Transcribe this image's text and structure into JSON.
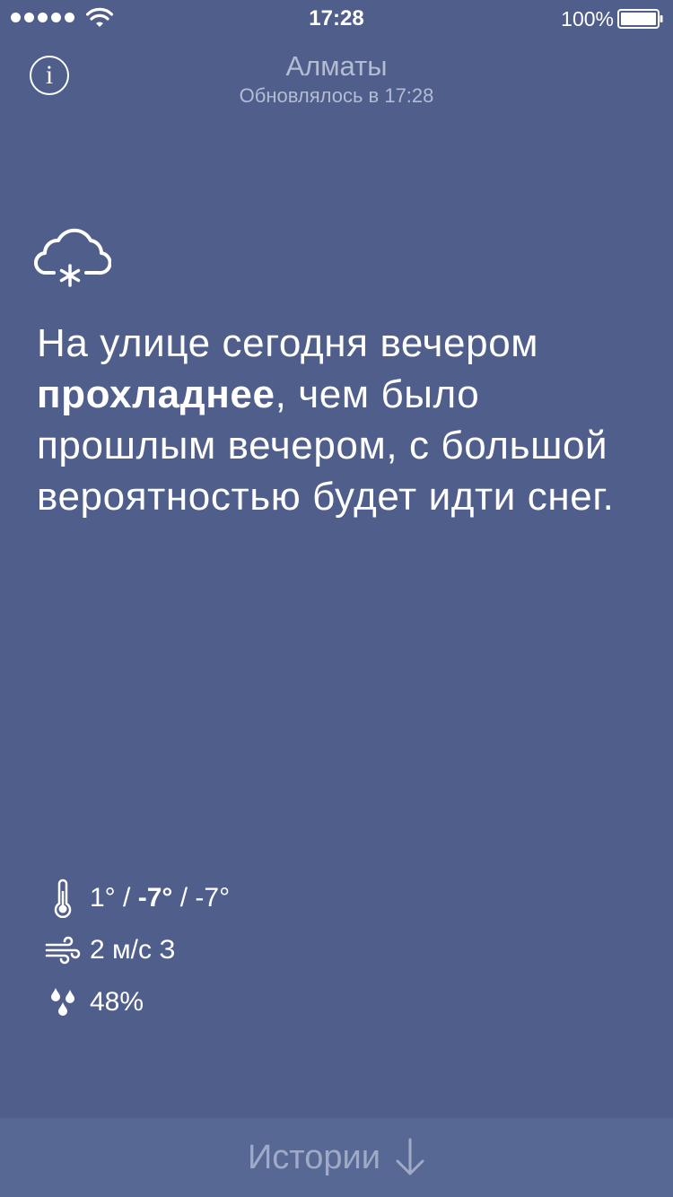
{
  "status_bar": {
    "time": "17:28",
    "battery_percent": "100%"
  },
  "header": {
    "info_icon": "info-icon",
    "city": "Алматы",
    "updated": "Обновлялось в 17:28"
  },
  "weather": {
    "icon": "snow-cloud-icon",
    "summary_part1": "На улице сегодня вечером ",
    "summary_bold": "прохладнее",
    "summary_part2": ", чем было прошлым вечером, с большой вероятностью будет идти снег."
  },
  "stats": {
    "temperature": {
      "icon": "thermometer-icon",
      "high": "1°",
      "sep1": " / ",
      "current": "-7°",
      "sep2": " / ",
      "low": "-7°"
    },
    "wind": {
      "icon": "wind-icon",
      "value": "2 м/с З"
    },
    "humidity": {
      "icon": "droplets-icon",
      "value": "48%"
    }
  },
  "bottom": {
    "label": "Истории",
    "arrow_icon": "arrow-down-icon"
  },
  "colors": {
    "background": "#4f5e8a",
    "bottom_bar": "#566893",
    "muted_text": "#b4bcd3"
  }
}
